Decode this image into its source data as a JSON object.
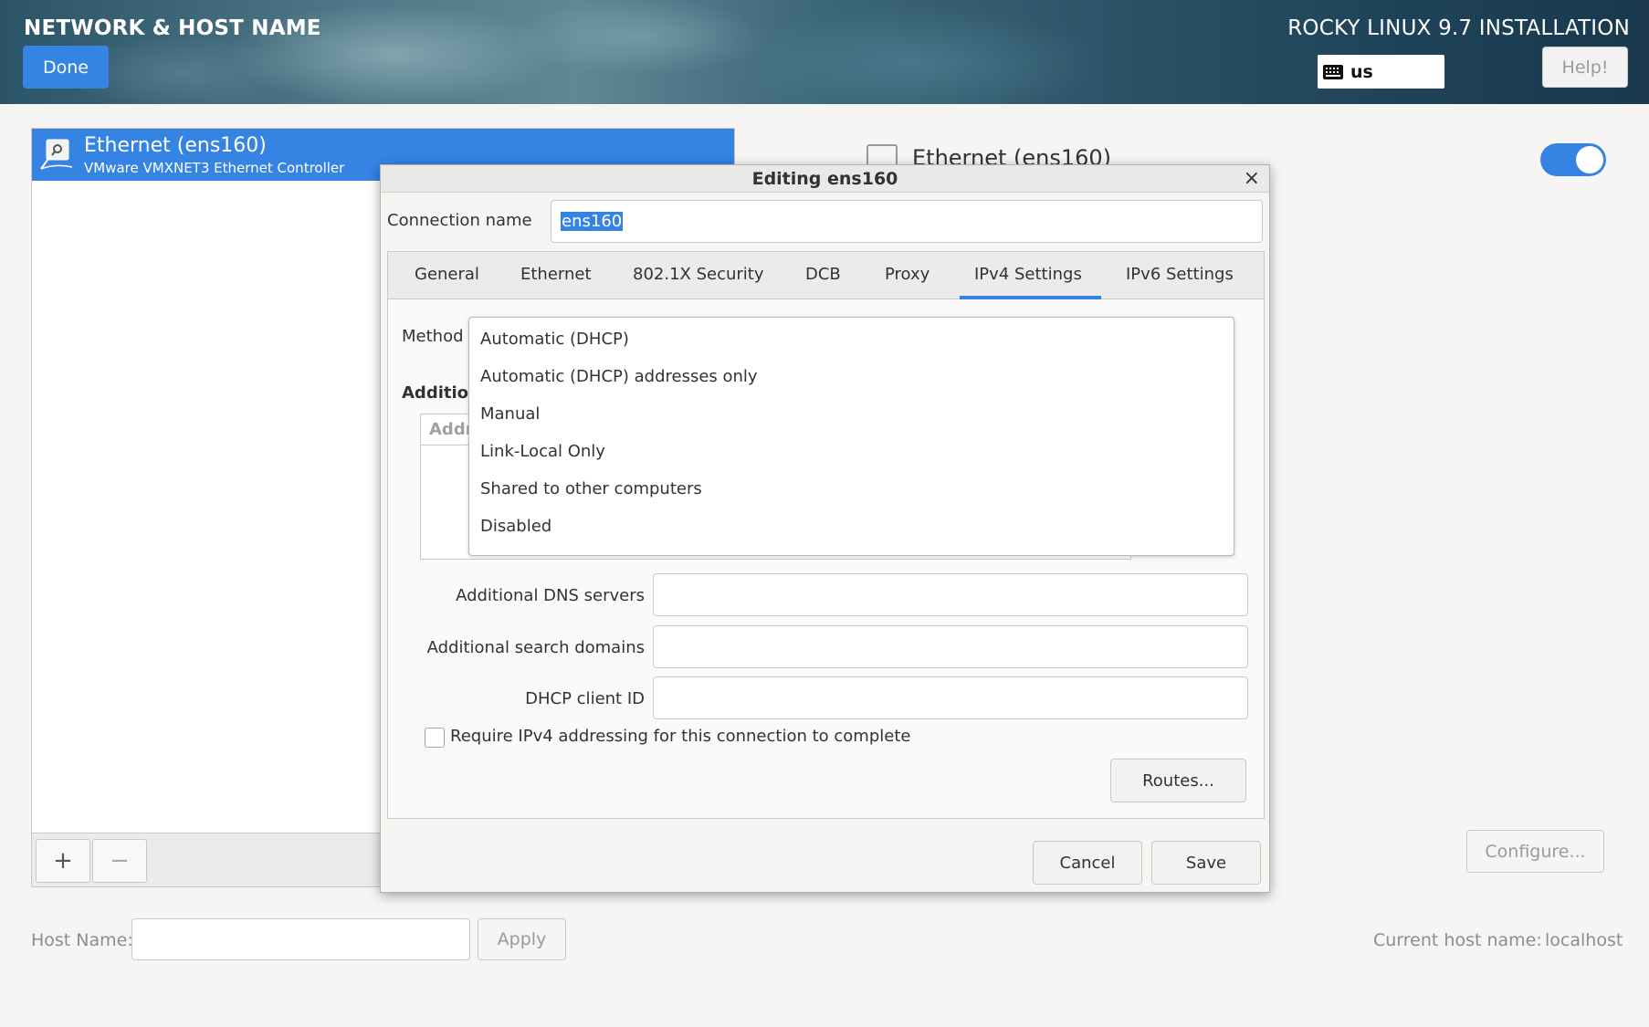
{
  "header": {
    "title": "NETWORK & HOST NAME",
    "done_label": "Done",
    "product": "ROCKY LINUX 9.7 INSTALLATION",
    "keyboard_layout": "us",
    "help_label": "Help!"
  },
  "network_list": {
    "items": [
      {
        "name": "Ethernet (ens160)",
        "description": "VMware VMXNET3 Ethernet Controller"
      }
    ],
    "add_label": "+",
    "remove_label": "−"
  },
  "details": {
    "title": "Ethernet (ens160)",
    "enabled": true,
    "configure_label": "Configure..."
  },
  "host": {
    "label": "Host Name:",
    "value": "",
    "apply_label": "Apply",
    "current_label": "Current host name:",
    "current_value": "localhost"
  },
  "dialog": {
    "title": "Editing ens160",
    "close_label": "×",
    "connection_name_label": "Connection name",
    "connection_name_value": "ens160",
    "tabs": [
      "General",
      "Ethernet",
      "802.1X Security",
      "DCB",
      "Proxy",
      "IPv4 Settings",
      "IPv6 Settings"
    ],
    "active_tab": "IPv4 Settings",
    "method_label": "Method",
    "method_options": [
      "Automatic (DHCP)",
      "Automatic (DHCP) addresses only",
      "Manual",
      "Link-Local Only",
      "Shared to other computers",
      "Disabled"
    ],
    "additional_label": "Addition",
    "address_column": "Addre",
    "dns_label": "Additional DNS servers",
    "dns_value": "",
    "search_label": "Additional search domains",
    "search_value": "",
    "dhcp_id_label": "DHCP client ID",
    "dhcp_id_value": "",
    "require_label": "Require IPv4 addressing for this connection to complete",
    "require_checked": false,
    "routes_label": "Routes...",
    "cancel_label": "Cancel",
    "save_label": "Save"
  },
  "colors": {
    "accent": "#3584e4",
    "background": "#f6f5f4"
  }
}
